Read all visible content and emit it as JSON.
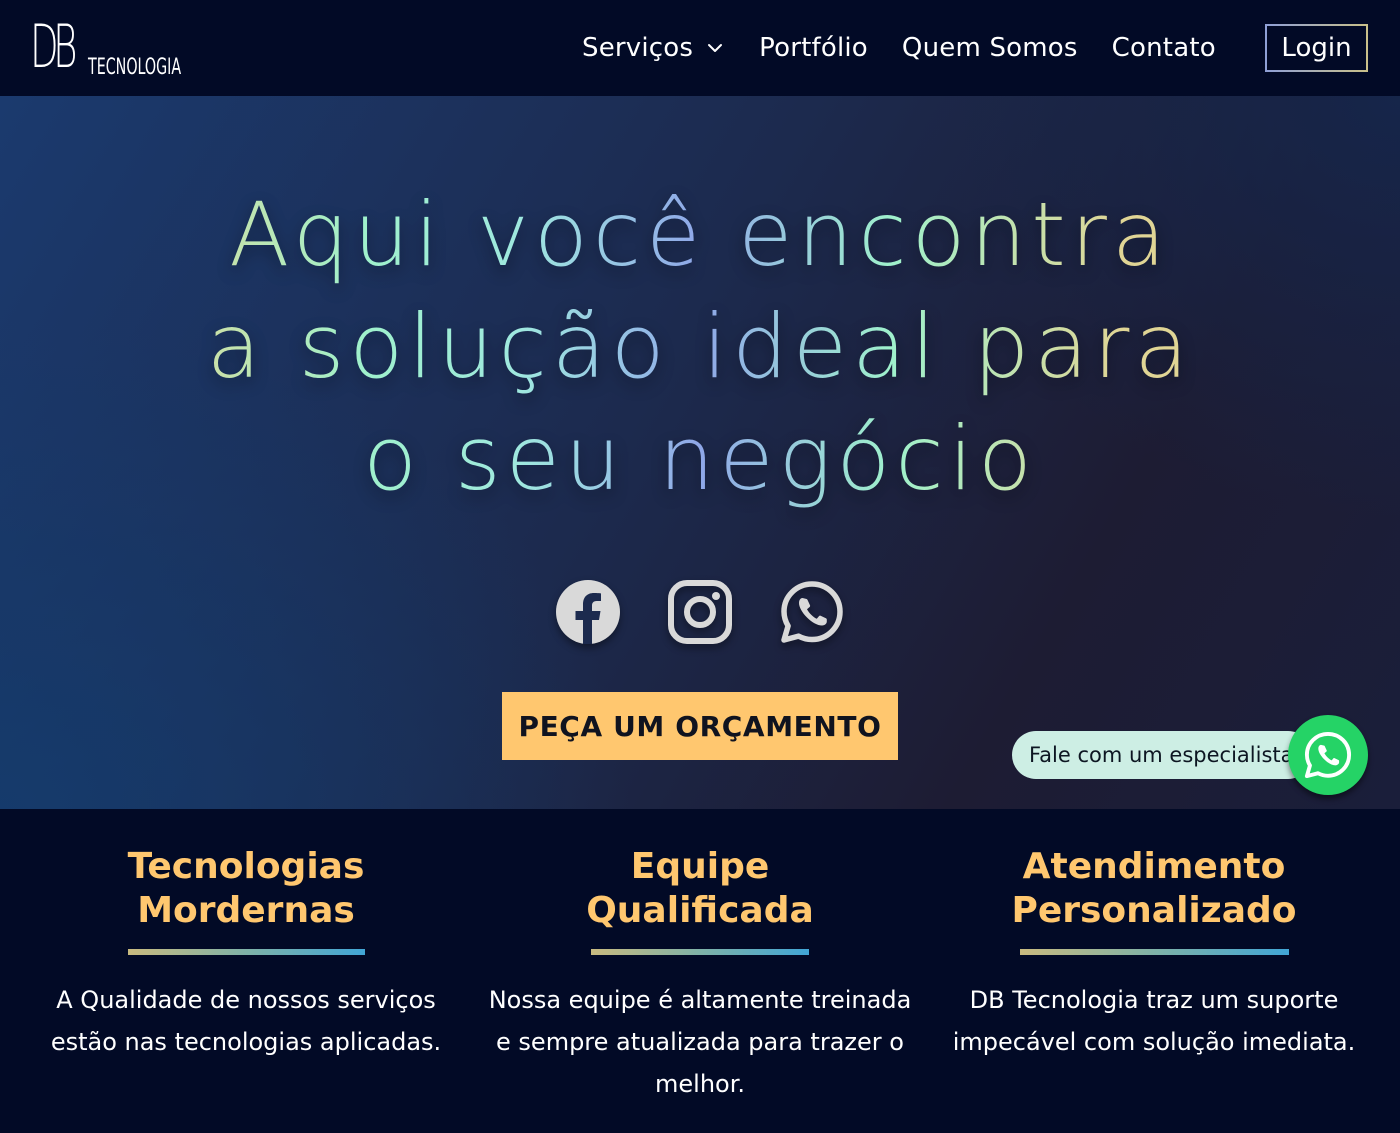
{
  "header": {
    "logo": {
      "mark": "DB",
      "sub": "TECNOLOGIA"
    },
    "nav": [
      {
        "label": "Serviços",
        "has_dropdown": true,
        "icon": "chevron-down-icon"
      },
      {
        "label": "Portfólio"
      },
      {
        "label": "Quem Somos"
      },
      {
        "label": "Contato"
      }
    ],
    "login_label": "Login"
  },
  "hero": {
    "headline_lines": [
      "Aqui você encontra",
      "a solução ideal para",
      "o seu negócio"
    ],
    "socials": [
      {
        "name": "facebook-icon"
      },
      {
        "name": "instagram-icon"
      },
      {
        "name": "whatsapp-icon"
      }
    ],
    "cta_label": "PEÇA UM ORÇAMENTO"
  },
  "chat_widget": {
    "label": "Fale com um especialista",
    "icon": "whatsapp-icon",
    "color": "#25d366"
  },
  "features": [
    {
      "title": "Tecnologias\nMordernas",
      "text": "A Qualidade de nossos serviços estão nas tecnologias aplicadas."
    },
    {
      "title": "Equipe\nQualificada",
      "text": "Nossa equipe é altamente treinada e sempre atualizada para trazer o melhor."
    },
    {
      "title": "Atendimento\nPersonalizado",
      "text": "DB Tecnologia traz um suporte impecável com solução imediata."
    }
  ],
  "colors": {
    "background": "#020a26",
    "accent": "#ffc76f",
    "chat_pill": "#cdeee4"
  }
}
